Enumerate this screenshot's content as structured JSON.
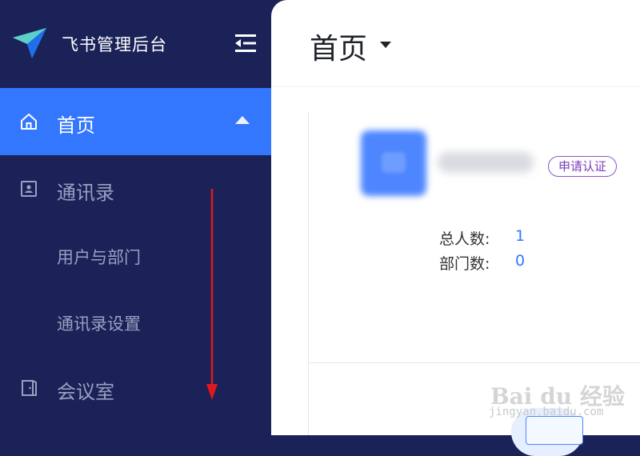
{
  "sidebar": {
    "app_title": "飞书管理后台",
    "items": [
      {
        "label": "首页",
        "icon": "home-icon",
        "active": true
      },
      {
        "label": "通讯录",
        "icon": "contacts-icon"
      },
      {
        "label": "用户与部门"
      },
      {
        "label": "通讯录设置"
      },
      {
        "label": "会议室",
        "icon": "meeting-room-icon"
      }
    ]
  },
  "main": {
    "page_title": "首页",
    "org": {
      "badge": "申请认证"
    },
    "stats": [
      {
        "label": "总人数:",
        "value": "1"
      },
      {
        "label": "部门数:",
        "value": "0"
      }
    ]
  },
  "watermark": {
    "text": "Bai du 经验",
    "sub": "jingyan.baidu.com"
  },
  "colors": {
    "sidebar_bg": "#1a2258",
    "accent": "#3377ff",
    "badge": "#8a56c8",
    "annotation_arrow": "#e0181e"
  }
}
